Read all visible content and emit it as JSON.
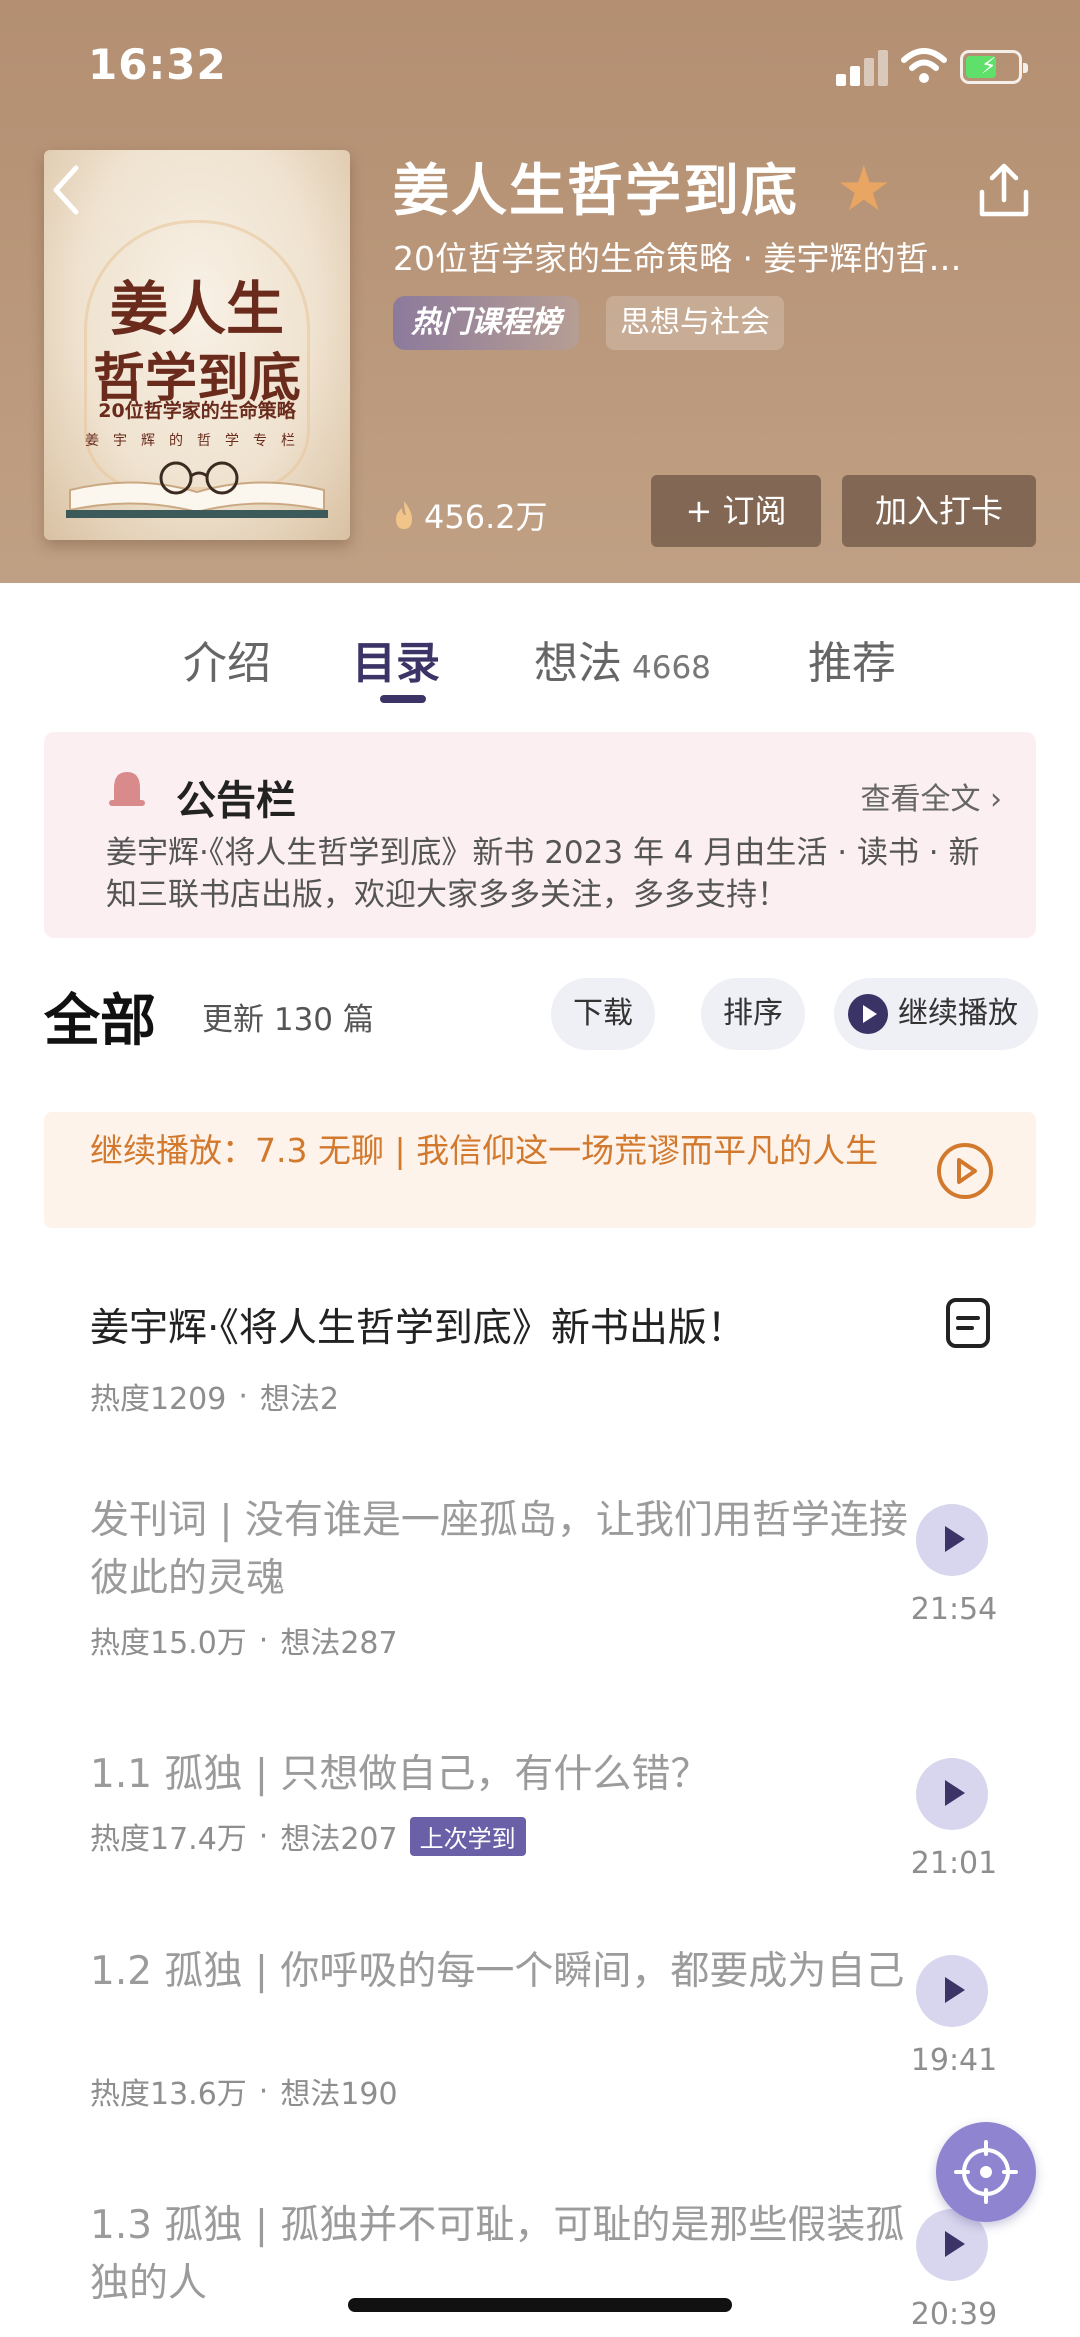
{
  "status_bar": {
    "time": "16:32"
  },
  "colors": {
    "accent": "#3c3466",
    "orange": "#d2792e",
    "star": "#e9a562",
    "battery": "#5ee06a"
  },
  "header": {
    "cover_title_line1": "姜人生",
    "cover_title_line2": "哲学到底",
    "cover_subtitle": "20位哲学家的生命策略",
    "cover_author": "姜宇辉的哲学专栏",
    "title": "姜人生哲学到底",
    "subtitle": "20位哲学家的生命策略 · 姜宇辉的哲…",
    "tag_hot": "热门课程榜",
    "tag_category": "思想与社会",
    "heat": "456.2万",
    "subscribe_label": "+ 订阅",
    "checkin_label": "加入打卡"
  },
  "tabs": [
    {
      "label": "介绍"
    },
    {
      "label": "目录"
    },
    {
      "label": "想法",
      "count": "4668"
    },
    {
      "label": "推荐"
    }
  ],
  "notice": {
    "title": "公告栏",
    "more": "查看全文",
    "text": "姜宇辉·《将人生哲学到底》新书 2023 年 4 月由生活 · 读书 · 新知三联书店出版，欢迎大家多多关注，多多支持！"
  },
  "section": {
    "title": "全部",
    "count": "更新 130 篇",
    "download": "下载",
    "sort": "排序",
    "continue_play": "继续播放"
  },
  "continue_bar": {
    "text": "继续播放：7.3 无聊 | 我信仰这一场荒谬而平凡的人生"
  },
  "items": [
    {
      "title": "姜宇辉·《将人生哲学到底》新书出版！",
      "heat": "热度1209",
      "ideas": "想法2"
    },
    {
      "title": "发刊词 | 没有谁是一座孤岛，让我们用哲学连接彼此的灵魂",
      "heat": "热度15.0万",
      "ideas": "想法287",
      "duration": "21:54"
    },
    {
      "title": "1.1 孤独 | 只想做自己，有什么错？",
      "heat": "热度17.4万",
      "ideas": "想法207",
      "badge": "上次学到",
      "duration": "21:01"
    },
    {
      "title": "1.2 孤独 | 你呼吸的每一个瞬间，都要成为自己",
      "heat": "热度13.6万",
      "ideas": "想法190",
      "duration": "19:41"
    },
    {
      "title": "1.3 孤独 | 孤独并不可耻，可耻的是那些假装孤独的人",
      "duration": "20:39"
    }
  ]
}
